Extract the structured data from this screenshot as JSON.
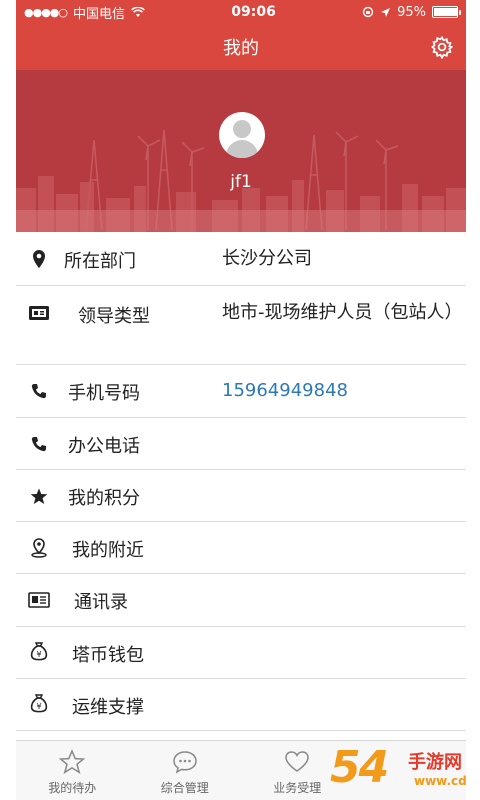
{
  "status_bar": {
    "signal": "●●●●○",
    "carrier": "中国电信",
    "time": "09:06",
    "battery_percent": "95%",
    "battery_level": 0.95
  },
  "navbar": {
    "title": "我的"
  },
  "profile": {
    "username": "jf1"
  },
  "list": [
    {
      "icon": "location-pin-icon",
      "label": "所在部门",
      "value": "长沙分公司"
    },
    {
      "icon": "id-card-icon",
      "label": "领导类型",
      "value": "地市-现场维护人员（包站人）"
    },
    {
      "icon": "phone-icon",
      "label": "手机号码",
      "value": "15964949848"
    },
    {
      "icon": "phone-icon",
      "label": "办公电话",
      "value": ""
    },
    {
      "icon": "star-icon",
      "label": "我的积分",
      "value": ""
    },
    {
      "icon": "nearby-pin-icon",
      "label": "我的附近",
      "value": ""
    },
    {
      "icon": "address-book-icon",
      "label": "通讯录",
      "value": ""
    },
    {
      "icon": "money-bag-icon",
      "label": "塔币钱包",
      "value": ""
    },
    {
      "icon": "money-bag-icon",
      "label": "运维支撑",
      "value": ""
    }
  ],
  "tabs": [
    {
      "icon": "star-outline-icon",
      "label": "我的待办"
    },
    {
      "icon": "chat-bubble-icon",
      "label": "综合管理"
    },
    {
      "icon": "heart-icon",
      "label": "业务受理"
    }
  ],
  "watermark": {
    "number": "54",
    "text": "手游网",
    "url": "www.cdcncn"
  },
  "colors": {
    "accent": "#d9473f",
    "banner": "#b23a3f",
    "link": "#2c79b8"
  }
}
